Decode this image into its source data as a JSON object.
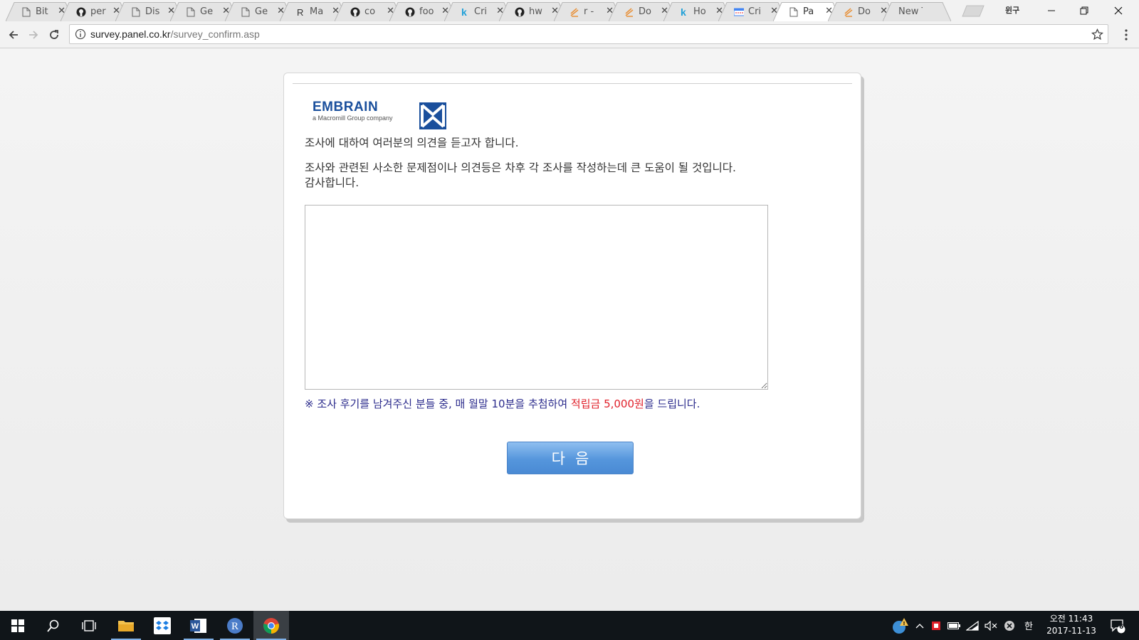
{
  "browser": {
    "tabs": [
      {
        "title": "Bit",
        "icon": "doc-icon",
        "active": false
      },
      {
        "title": "per",
        "icon": "github-icon",
        "active": false
      },
      {
        "title": "Dis",
        "icon": "doc-icon",
        "active": false
      },
      {
        "title": "Ge",
        "icon": "doc-icon",
        "active": false
      },
      {
        "title": "Ge",
        "icon": "doc-icon",
        "active": false
      },
      {
        "title": "Ma",
        "icon": "r-icon",
        "active": false
      },
      {
        "title": "co",
        "icon": "github-icon",
        "active": false
      },
      {
        "title": "foo",
        "icon": "github-icon",
        "active": false
      },
      {
        "title": "Cri",
        "icon": "k-icon",
        "active": false
      },
      {
        "title": "hw",
        "icon": "github-icon",
        "active": false
      },
      {
        "title": "r -",
        "icon": "stack-icon",
        "active": false
      },
      {
        "title": "Do",
        "icon": "stack-icon",
        "active": false
      },
      {
        "title": "Ho",
        "icon": "k-icon",
        "active": false
      },
      {
        "title": "Cri",
        "icon": "calendar-icon",
        "active": false
      },
      {
        "title": "Pa",
        "icon": "doc-icon",
        "active": true
      },
      {
        "title": "Do",
        "icon": "stack-icon",
        "active": false
      },
      {
        "title": "New T",
        "icon": "",
        "active": false
      }
    ],
    "profile_label": "윈구",
    "url_host": "survey.panel.co.kr",
    "url_path": "/survey_confirm.asp"
  },
  "page": {
    "logo": {
      "brand": "EMBRAIN",
      "tagline": "a Macromill Group company"
    },
    "message_line1": "조사에 대하여 여러분의 의견을 듣고자 합니다.",
    "message_line2": "조사와 관련된 사소한 문제점이나 의견등은 차후 각 조사를 작성하는데 큰 도움이 될 것입니다.",
    "message_line3": "감사합니다.",
    "feedback_value": "",
    "notice": {
      "prefix": "※ 조사 후기를 남겨주신 분들 중, 매 월말 10분을 추첨하여 ",
      "highlight": "적립금 5,000원",
      "suffix": "을 드립니다."
    },
    "next_button": "다음"
  },
  "taskbar": {
    "apps": [
      "start-icon",
      "search-icon",
      "task-view-icon",
      "file-explorer-icon",
      "dropbox-icon",
      "word-icon",
      "r-icon",
      "chrome-icon"
    ],
    "ime_label": "한",
    "clock_time": "오전 11:43",
    "clock_date": "2017-11-13",
    "notification_count": "6"
  },
  "colors": {
    "brand_blue": "#1a4f9c",
    "notice_blue": "#2b2b8c",
    "notice_red": "#e0202a",
    "button_blue": "#5596dc"
  }
}
